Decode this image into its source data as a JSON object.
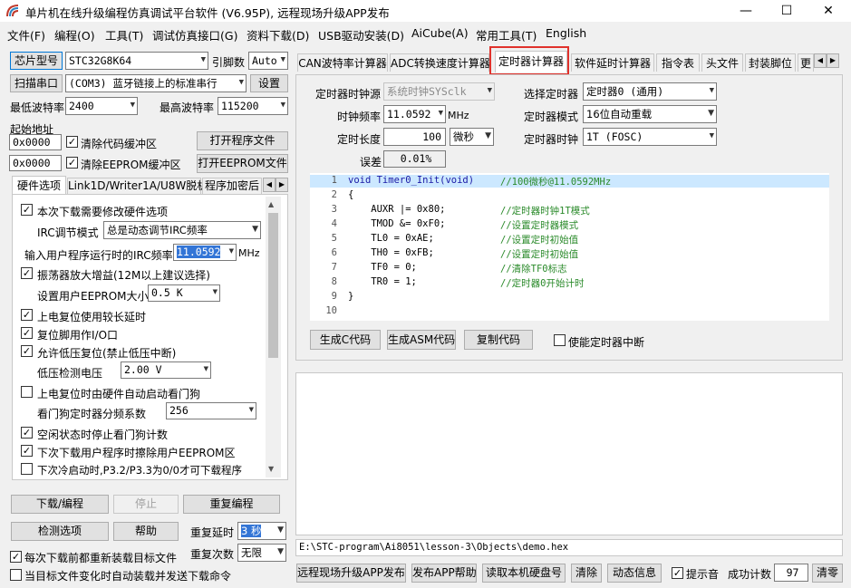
{
  "app": {
    "title": "单片机在线升级编程仿真调试平台软件 (V6.95P), 远程现场升级APP发布",
    "min": "—",
    "max": "☐",
    "close": "✕"
  },
  "menus": [
    "文件(F)",
    "编程(O)",
    "工具(T)",
    "调试仿真接口(G)",
    "资料下载(D)",
    "USB驱动安装(D)",
    "AiCube(A)",
    "常用工具(T)",
    "English"
  ],
  "left": {
    "chip_button": "芯片型号",
    "chip_value": "STC32G8K64",
    "pins_label": "引脚数",
    "pins_value": "Auto",
    "scan_button": "扫描串口",
    "port_value": "(COM3) 蓝牙链接上的标准串行",
    "settings_button": "设置",
    "min_baud_label": "最低波特率",
    "min_baud_value": "2400",
    "max_baud_label": "最高波特率",
    "max_baud_value": "115200",
    "start_addr_label": "起始地址",
    "addr1": "0x0000",
    "clear_code": "清除代码缓冲区",
    "open_program": "打开程序文件",
    "addr2": "0x0000",
    "clear_eeprom": "清除EEPROM缓冲区",
    "open_eeprom": "打开EEPROM文件",
    "tabs": [
      "硬件选项",
      "Link1D/Writer1A/U8W脱机",
      "程序加密后"
    ],
    "opt_modify_hw": "本次下载需要修改硬件选项",
    "irc_mode_label": "IRC调节模式",
    "irc_mode_value": "总是动态调节IRC频率",
    "irc_freq_label": "输入用户程序运行时的IRC频率",
    "irc_freq_value": "11.0592",
    "irc_unit": "MHz",
    "opt_osc_gain": "振荡器放大增益(12M以上建议选择)",
    "eeprom_size_label": "设置用户EEPROM大小",
    "eeprom_size_value": "0.5 K",
    "opt_power_delay": "上电复位使用较长延时",
    "opt_reset_io": "复位脚用作I/O口",
    "opt_lvr": "允许低压复位(禁止低压中断)",
    "lvd_label": "低压检测电压",
    "lvd_value": "2.00 V",
    "opt_wdt": "上电复位时由硬件自动启动看门狗",
    "wdt_div_label": "看门狗定时器分频系数",
    "wdt_div_value": "256",
    "opt_idle_wdt": "空闲状态时停止看门狗计数",
    "opt_erase_eeprom": "下次下载用户程序时擦除用户EEPROM区",
    "opt_cold_boot": "下次冷启动时,P3.2/P3.3为0/0才可下载程序",
    "download_button": "下载/编程",
    "stop_button": "停止",
    "reprogram_button": "重复编程",
    "check_button": "检测选项",
    "help_button": "帮助",
    "repeat_delay_label": "重复延时",
    "repeat_delay_value": "3 秒",
    "repeat_count_label": "重复次数",
    "repeat_count_value": "无限",
    "opt_reload": "每次下载前都重新装载目标文件",
    "opt_auto_load": "当目标文件变化时自动装载并发送下载命令"
  },
  "right": {
    "tabs": [
      "CAN波特率计算器",
      "ADC转换速度计算器",
      "定时器计算器",
      "软件延时计算器",
      "指令表",
      "头文件",
      "封装脚位",
      "更"
    ],
    "clock_src_label": "定时器时钟源",
    "clock_src_value": "系统时钟SYSclk",
    "timer_sel_label": "选择定时器",
    "timer_sel_value": "定时器0 (通用)",
    "freq_label": "时钟频率",
    "freq_value": "11.0592",
    "freq_unit": "MHz",
    "mode_label": "定时器模式",
    "mode_value": "16位自动重载",
    "length_label": "定时长度",
    "length_value": "100",
    "length_unit": "微秒",
    "tclk_label": "定时器时钟",
    "tclk_value": "1T  (FOSC)",
    "error_label": "误差",
    "error_value": "0.01%",
    "code_lines": [
      {
        "n": "1",
        "code": "void Timer0_Init(void)",
        "comment": "//100微秒@11.0592MHz"
      },
      {
        "n": "2",
        "code": "{",
        "comment": ""
      },
      {
        "n": "3",
        "code": "    AUXR |= 0x80;",
        "comment": "//定时器时钟1T模式"
      },
      {
        "n": "4",
        "code": "    TMOD &= 0xF0;",
        "comment": "//设置定时器模式"
      },
      {
        "n": "5",
        "code": "    TL0 = 0xAE;",
        "comment": "//设置定时初始值"
      },
      {
        "n": "6",
        "code": "    TH0 = 0xFB;",
        "comment": "//设置定时初始值"
      },
      {
        "n": "7",
        "code": "    TF0 = 0;",
        "comment": "//清除TF0标志"
      },
      {
        "n": "8",
        "code": "    TR0 = 1;",
        "comment": "//定时器0开始计时"
      },
      {
        "n": "9",
        "code": "}",
        "comment": ""
      },
      {
        "n": "10",
        "code": "",
        "comment": ""
      }
    ],
    "gen_c_button": "生成C代码",
    "gen_asm_button": "生成ASM代码",
    "copy_button": "复制代码",
    "enable_int": "使能定时器中断",
    "path": "E:\\STC-program\\Ai8051\\lesson-3\\Objects\\demo.hex",
    "remote_button": "远程现场升级APP发布",
    "publish_help_button": "发布APP帮助",
    "disk_button": "读取本机硬盘号",
    "clear_button": "清除",
    "anim_button": "动态信息",
    "beep_label": "提示音",
    "success_label": "成功计数",
    "success_value": "97",
    "zero_button": "清零"
  },
  "colors": {
    "accent_tab_border": "#e0322c",
    "code_highlight": "#cce8ff",
    "selection": "#3375d6"
  }
}
